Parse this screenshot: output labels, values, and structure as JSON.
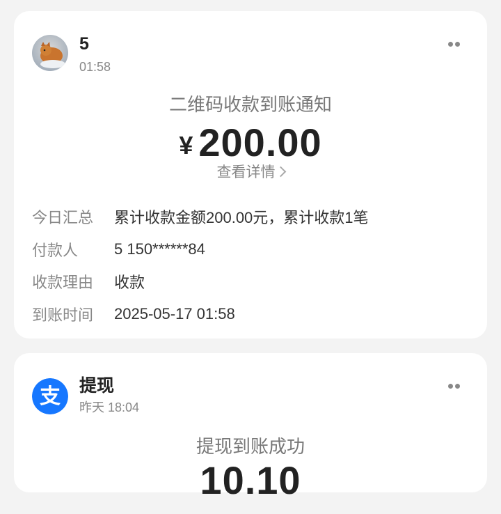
{
  "card1": {
    "sender": "5",
    "time": "01:58",
    "title": "二维码收款到账通知",
    "currency": "¥",
    "amount": "200.00",
    "detail_link": "查看详情",
    "rows": [
      {
        "label": "今日汇总",
        "value": "累计收款金额200.00元，累计收款1笔"
      },
      {
        "label": "付款人",
        "value": "5 150******84"
      },
      {
        "label": "收款理由",
        "value": "收款"
      },
      {
        "label": "到账时间",
        "value": "2025-05-17 01:58"
      }
    ]
  },
  "card2": {
    "sender": "提现",
    "time": "昨天 18:04",
    "title": "提现到账成功",
    "amount": "10.10",
    "avatar_color": "#1677ff",
    "avatar_glyph": "支"
  },
  "colors": {
    "background": "#f3f3f3",
    "card": "#ffffff",
    "muted": "#888888",
    "alipay_blue": "#1677ff"
  },
  "icons": [
    "avatar-photo-icon",
    "more-icon",
    "chevron-right-icon",
    "alipay-logo-icon"
  ]
}
